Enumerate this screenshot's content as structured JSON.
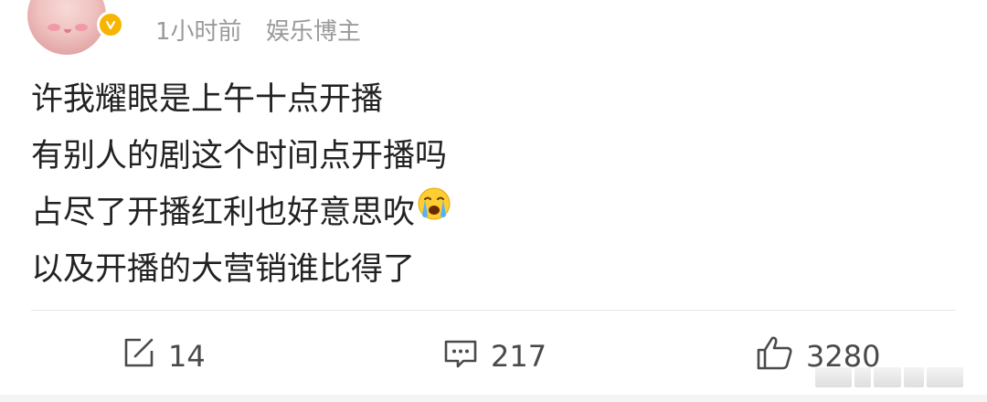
{
  "post": {
    "time": "1小时前",
    "role": "娱乐博主",
    "lines": [
      "许我耀眼是上午十点开播",
      "有别人的剧这个时间点开播吗",
      "占尽了开播红利也好意思吹",
      "以及开播的大营销谁比得了"
    ],
    "emoji": "crying-face-emoji"
  },
  "actions": {
    "repost_count": "14",
    "comment_count": "217",
    "like_count": "3280"
  },
  "icons": {
    "repost": "repost-icon",
    "comment": "comment-icon",
    "like": "thumbs-up-icon",
    "verified": "verified-badge-icon"
  },
  "colors": {
    "meta_text": "#9a9a9a",
    "verified": "#f7b500",
    "body_text": "#222222"
  }
}
